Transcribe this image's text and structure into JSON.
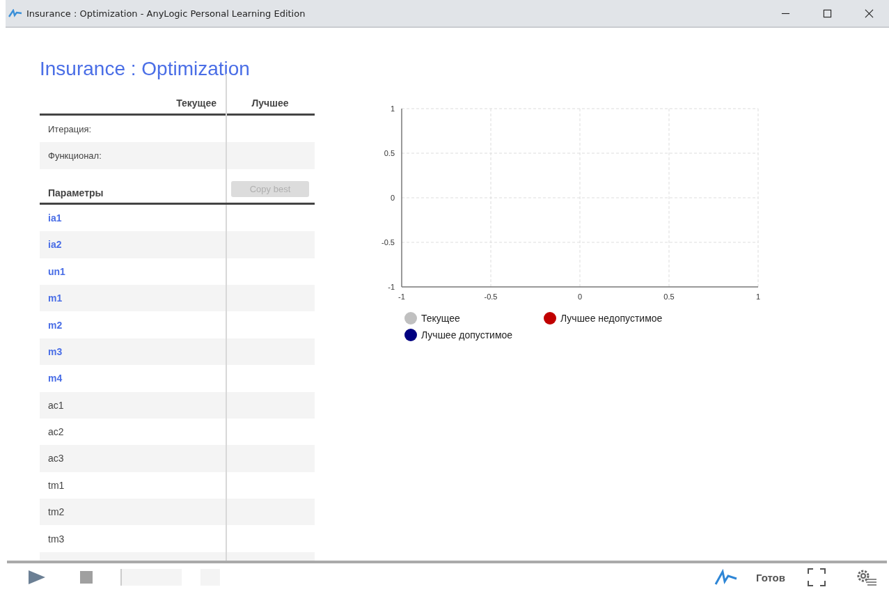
{
  "window": {
    "title": "Insurance : Optimization - AnyLogic Personal Learning Edition"
  },
  "page_title": "Insurance : Optimization",
  "table": {
    "columns": [
      "Текущее",
      "Лучшее"
    ],
    "rows": [
      {
        "label": "Итерация:"
      },
      {
        "label": "Функционал:"
      }
    ]
  },
  "parameters": {
    "heading": "Параметры",
    "copy_button": {
      "label": "Copy best",
      "disabled": true
    },
    "rows": [
      {
        "name": "ia1",
        "kind": "link"
      },
      {
        "name": "ia2",
        "kind": "link"
      },
      {
        "name": "un1",
        "kind": "link"
      },
      {
        "name": "m1",
        "kind": "link"
      },
      {
        "name": "m2",
        "kind": "link"
      },
      {
        "name": "m3",
        "kind": "link"
      },
      {
        "name": "m4",
        "kind": "link"
      },
      {
        "name": "ac1",
        "kind": "plain"
      },
      {
        "name": "ac2",
        "kind": "plain"
      },
      {
        "name": "ac3",
        "kind": "plain"
      },
      {
        "name": "tm1",
        "kind": "plain"
      },
      {
        "name": "tm2",
        "kind": "plain"
      },
      {
        "name": "tm3",
        "kind": "plain"
      }
    ]
  },
  "chart": {
    "chart_data": {
      "type": "scatter",
      "categories": [
        "-1",
        "-0.5",
        "0",
        "0.5",
        "1"
      ],
      "ylim": [
        -1,
        1
      ],
      "yticks": [
        -1,
        -0.5,
        0,
        0.5,
        1
      ],
      "grid": true,
      "series": [
        {
          "name": "Текущее",
          "color": "#c0c0c0",
          "values": [
            null,
            null,
            null,
            null,
            null
          ]
        },
        {
          "name": "Лучшее недопустимое",
          "color": "#c00000",
          "values": [
            null,
            null,
            null,
            null,
            null
          ]
        },
        {
          "name": "Лучшее допустимое",
          "color": "#000080",
          "values": [
            null,
            null,
            null,
            null,
            null
          ]
        }
      ]
    }
  },
  "status_bar": {
    "status": "Готов"
  }
}
